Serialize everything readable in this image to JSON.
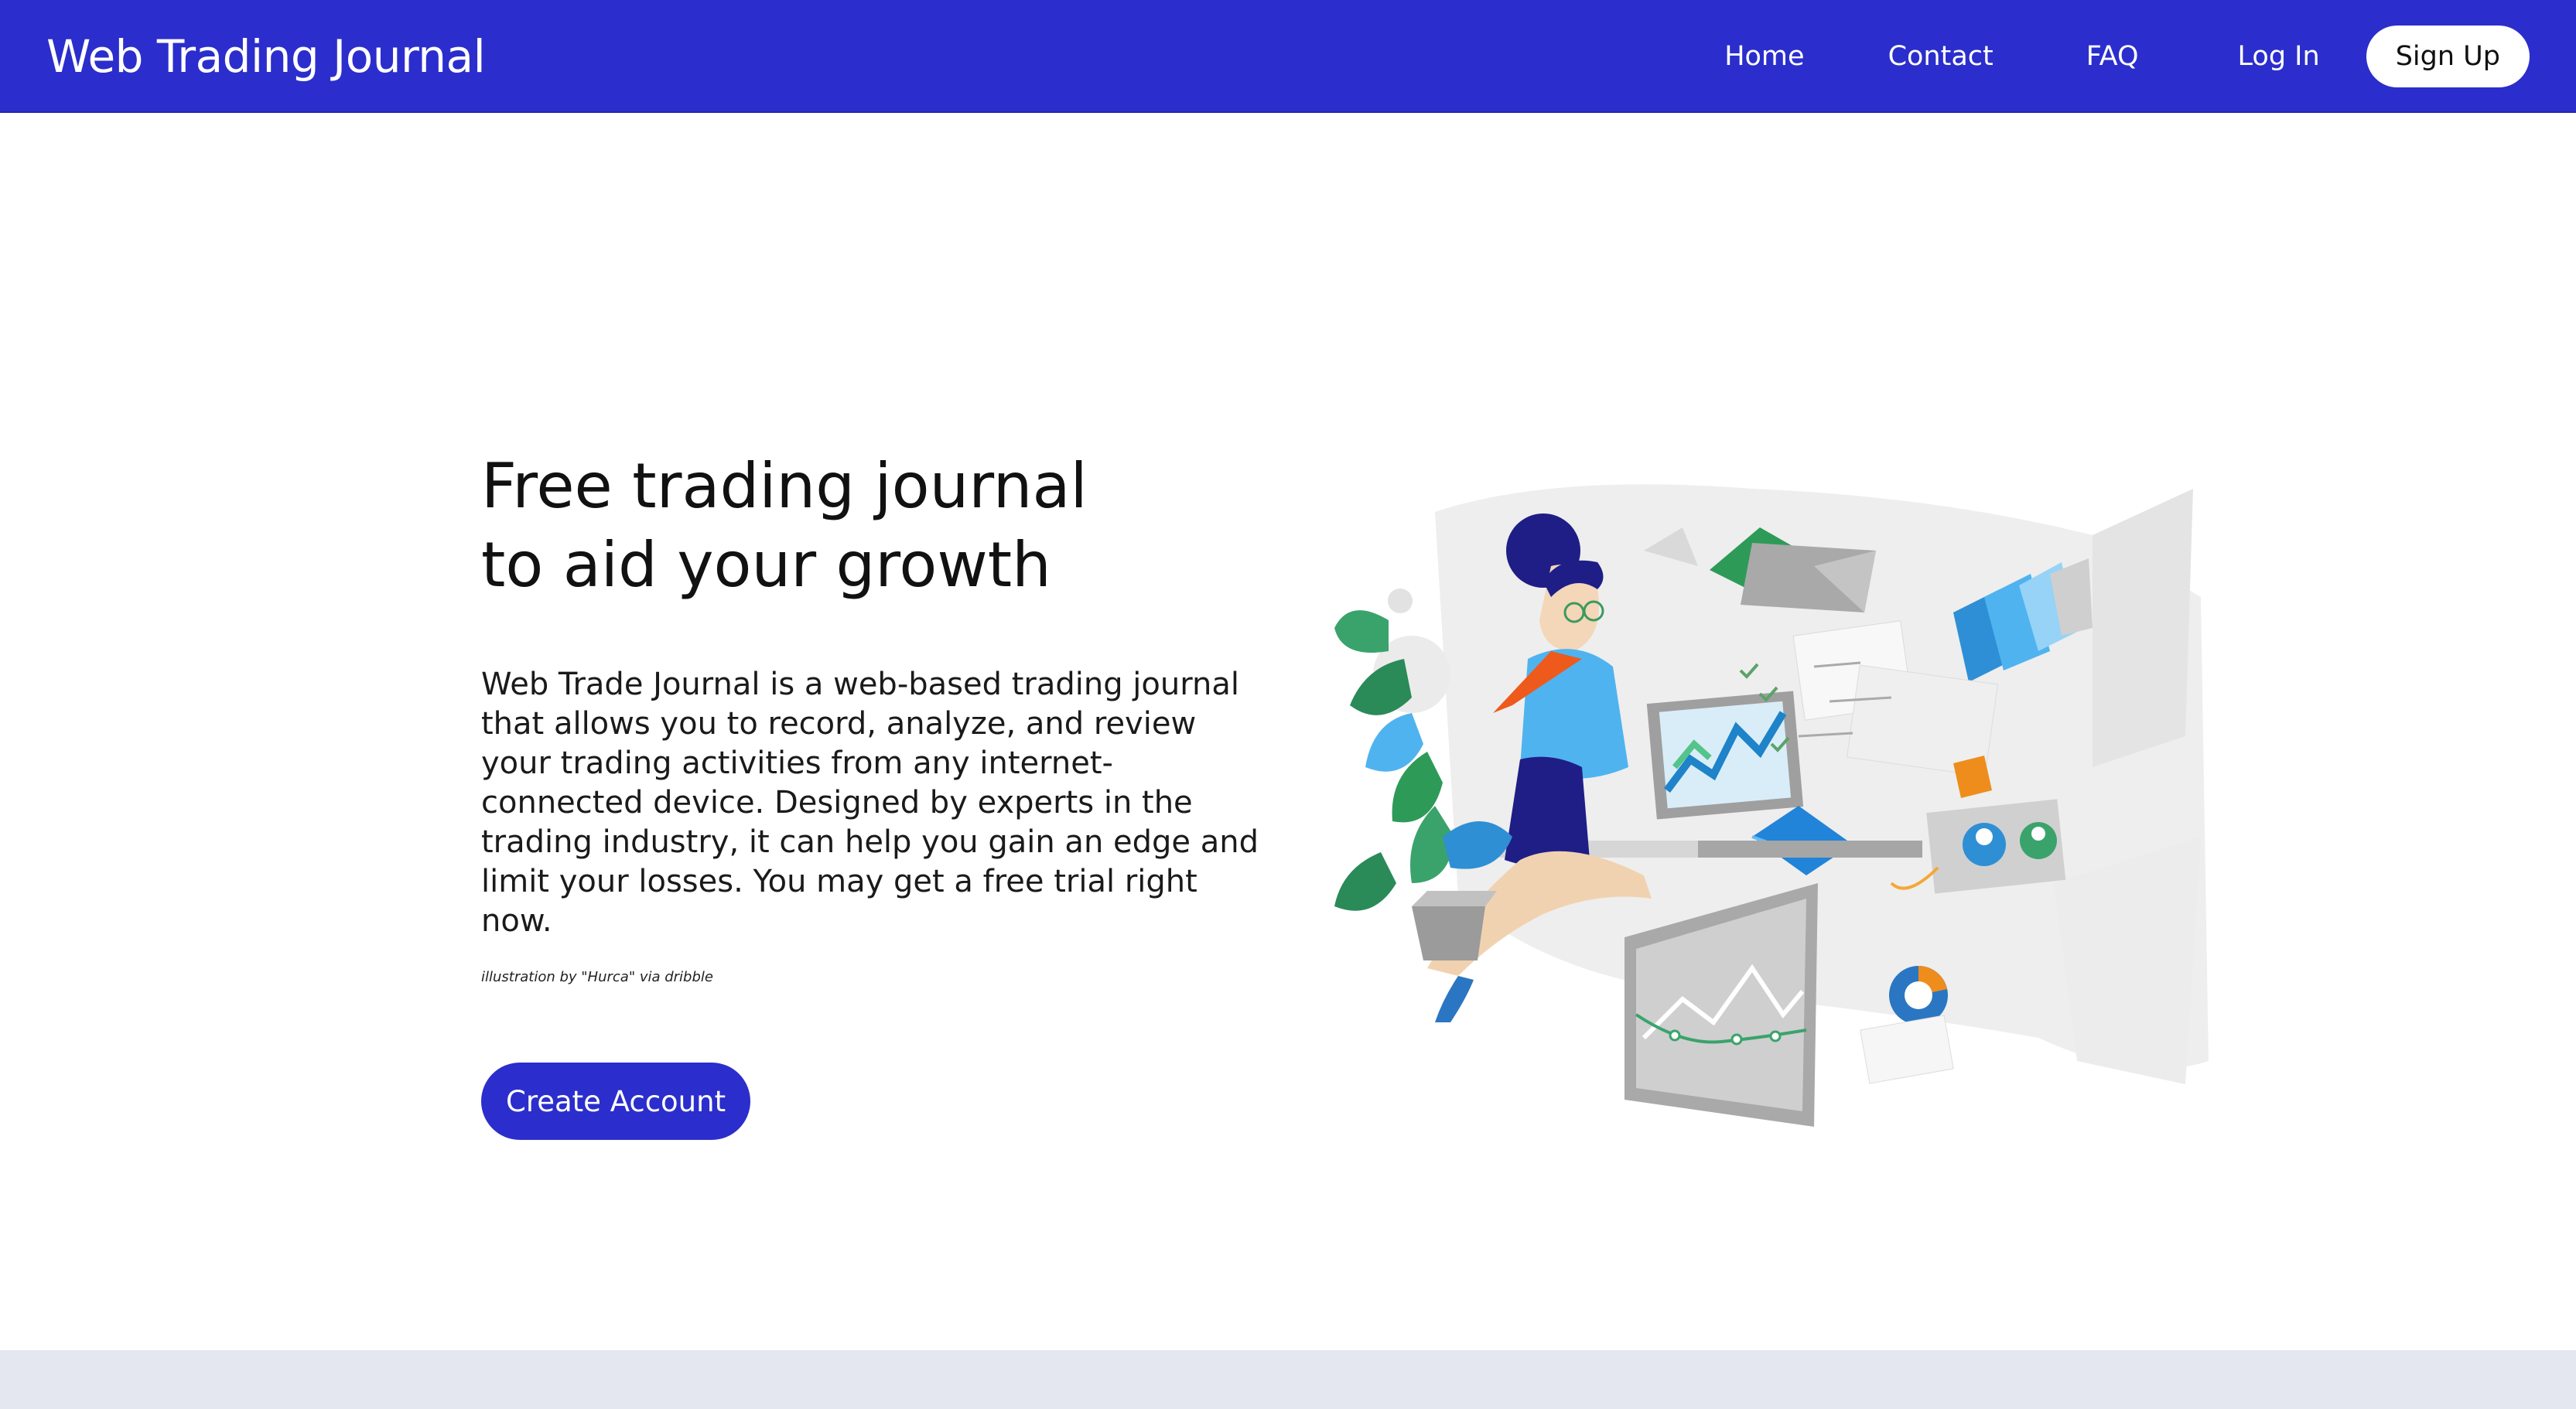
{
  "nav": {
    "brand": "Web Trading Journal",
    "links": [
      "Home",
      "Contact",
      "FAQ",
      "Log In"
    ],
    "signup_label": "Sign Up"
  },
  "hero": {
    "title_line1": "Free trading journal",
    "title_line2": "to aid your growth",
    "description": "Web Trade Journal is a web-based trading journal that allows you to record, analyze, and review your trading activities from any internet-connected device. Designed by experts in the trading industry, it can help you gain an edge and limit your losses. You may get a free trial right now.",
    "credit": "illustration by \"Hurca\" via dribble",
    "cta_label": "Create Account"
  },
  "colors": {
    "brand": "#2b2ecc",
    "footer_band": "#e4e7ef"
  }
}
